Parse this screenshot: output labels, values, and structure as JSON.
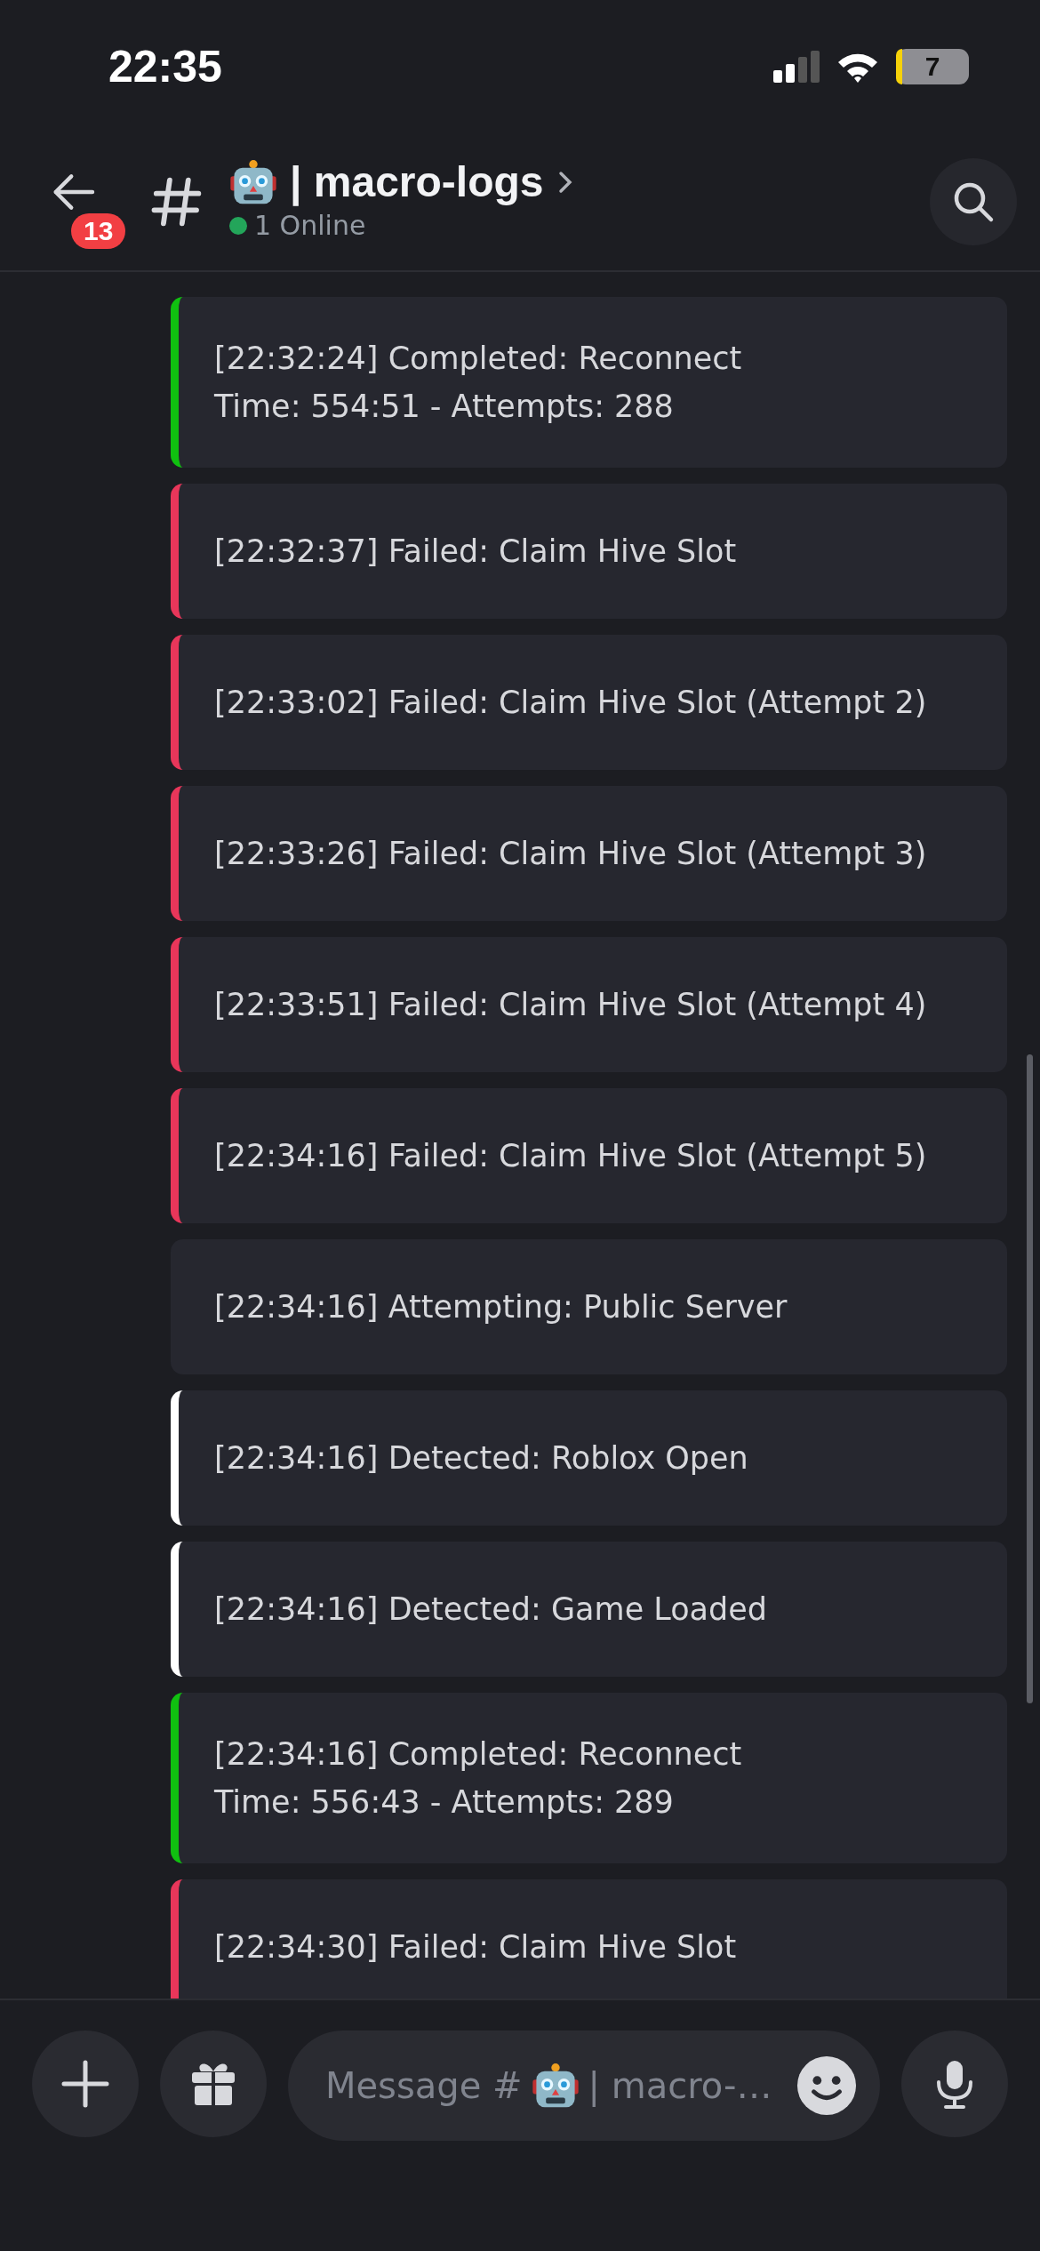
{
  "status_bar": {
    "time": "22:35",
    "battery": "7"
  },
  "header": {
    "unread_badge": "13",
    "channel_name": "| macro-logs",
    "online": "1 Online"
  },
  "messages": [
    {
      "lines": [
        "[22:32:24] Completed: Reconnect",
        "Time: 554:51 - Attempts: 288"
      ],
      "color": "#10c010"
    },
    {
      "lines": [
        "[22:32:37] Failed: Claim Hive Slot"
      ],
      "color": "#e8365a"
    },
    {
      "lines": [
        "[22:33:02] Failed: Claim Hive Slot (Attempt 2)"
      ],
      "color": "#e8365a"
    },
    {
      "lines": [
        "[22:33:26] Failed: Claim Hive Slot (Attempt 3)"
      ],
      "color": "#e8365a"
    },
    {
      "lines": [
        "[22:33:51] Failed: Claim Hive Slot (Attempt 4)"
      ],
      "color": "#e8365a"
    },
    {
      "lines": [
        "[22:34:16] Failed: Claim Hive Slot (Attempt 5)"
      ],
      "color": "#e8365a"
    },
    {
      "lines": [
        "[22:34:16] Attempting: Public Server"
      ]
    },
    {
      "lines": [
        "[22:34:16] Detected: Roblox Open"
      ],
      "color": "#ffffff"
    },
    {
      "lines": [
        "[22:34:16] Detected: Game Loaded"
      ],
      "color": "#ffffff"
    },
    {
      "lines": [
        "[22:34:16] Completed: Reconnect",
        "Time: 556:43 - Attempts: 289"
      ],
      "color": "#10c010"
    },
    {
      "lines": [
        "[22:34:30] Failed: Claim Hive Slot"
      ],
      "color": "#e8365a"
    }
  ],
  "composer": {
    "placeholder_start": "Message #",
    "placeholder_end": "| macro-…"
  }
}
